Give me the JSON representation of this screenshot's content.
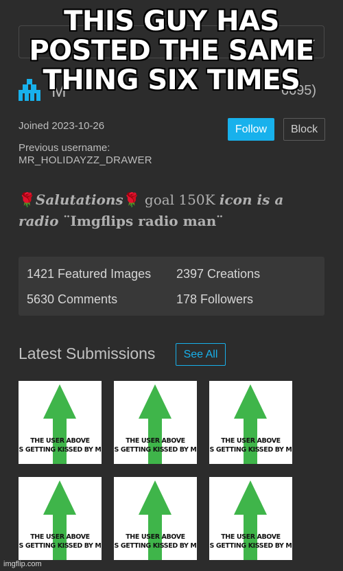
{
  "meme": {
    "caption": "THIS GUY HAS POSTED THE SAME THING SIX TIMES"
  },
  "user": {
    "name_visible": "M",
    "id_visible": "6695)",
    "joined": "Joined 2023-10-26",
    "previous_label": "Previous username:",
    "previous_username": "MR_HOLIDAYZZ_DRAWER"
  },
  "actions": {
    "follow": "Follow",
    "block": "Block"
  },
  "bio": {
    "rose": "🌹",
    "part1": "Salutations",
    "part2": " goal 150K ",
    "part3": "icon is a radio",
    "part4": " ¨Imgflips radio man¨"
  },
  "stats": {
    "featured": "1421 Featured Images",
    "creations": "2397 Creations",
    "comments": "5630 Comments",
    "followers": "178 Followers"
  },
  "latest": {
    "title": "Latest Submissions",
    "see_all": "See All"
  },
  "thumb_caption": {
    "line1": "THE USER ABOVE",
    "line2": "S GETTING KISSED BY M"
  },
  "watermark": "imgflip.com",
  "colors": {
    "accent": "#18b1ec",
    "arrow": "#3fb54a",
    "background": "#2c2c2c"
  }
}
